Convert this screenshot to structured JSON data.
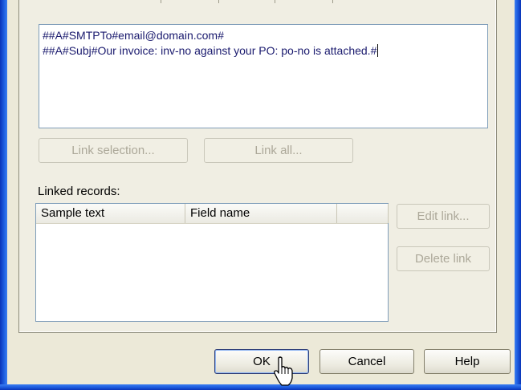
{
  "editor": {
    "lines": [
      "##A#SMTPTo#email@domain.com#",
      "##A#Subj#Our invoice: inv-no against your PO: po-no is attached.#"
    ]
  },
  "buttons": {
    "link_selection": "Link selection...",
    "link_all": "Link all...",
    "edit_link": "Edit link...",
    "delete_link": "Delete link",
    "ok": "OK",
    "cancel": "Cancel",
    "help": "Help"
  },
  "linked_records": {
    "label": "Linked records:",
    "columns": [
      "Sample text",
      "Field name",
      ""
    ]
  }
}
